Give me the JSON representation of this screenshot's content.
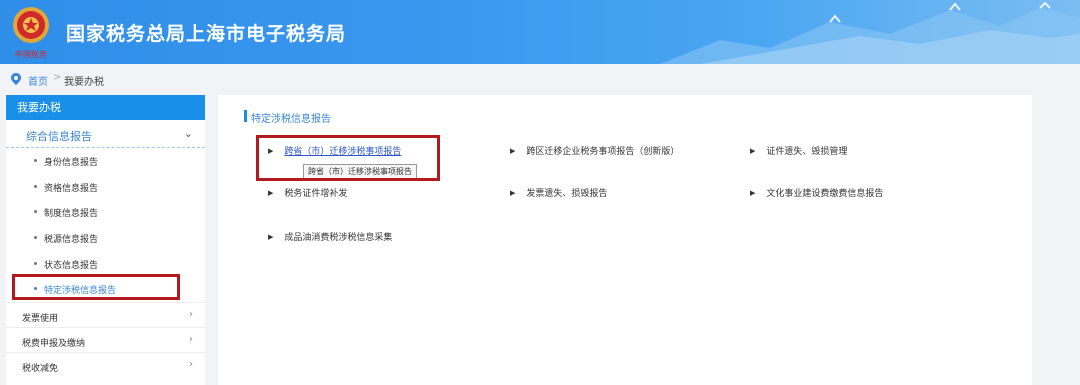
{
  "header": {
    "title": "国家税务总局上海市电子税务局",
    "colors": {
      "brand": "#2f8ee8",
      "emblem_red": "#d12a2a",
      "emblem_gold": "#e0a73a"
    },
    "emblem_icon": "tax-emblem-icon"
  },
  "breadcrumb": {
    "home": "首页",
    "separator": ">",
    "current": "我要办税"
  },
  "sidebar": {
    "head": "我要办税",
    "section": {
      "label": "综合信息报告",
      "expanded": true
    },
    "sub_items": [
      {
        "label": "身份信息报告",
        "active": false
      },
      {
        "label": "资格信息报告",
        "active": false
      },
      {
        "label": "制度信息报告",
        "active": false
      },
      {
        "label": "税源信息报告",
        "active": false
      },
      {
        "label": "状态信息报告",
        "active": false
      },
      {
        "label": "特定涉税信息报告",
        "active": true
      }
    ],
    "items": [
      {
        "label": "发票使用"
      },
      {
        "label": "税费申报及缴纳"
      },
      {
        "label": "税收减免"
      }
    ]
  },
  "content": {
    "title": "特定涉税信息报告",
    "links": [
      {
        "label": "跨省（市）迁移涉税事项报告",
        "active": true
      },
      {
        "label": "跨区迁移企业税务事项报告（创新版）",
        "active": false
      },
      {
        "label": "证件遗失、毁损管理",
        "active": false
      },
      {
        "label": "税务证件增补发",
        "active": false
      },
      {
        "label": "发票遗失、损毁报告",
        "active": false
      },
      {
        "label": "文化事业建设费缴费信息报告",
        "active": false
      },
      {
        "label": "成品油消费税涉税信息采集",
        "active": false
      }
    ],
    "tooltip": "跨省（市）迁移涉税事项报告"
  }
}
